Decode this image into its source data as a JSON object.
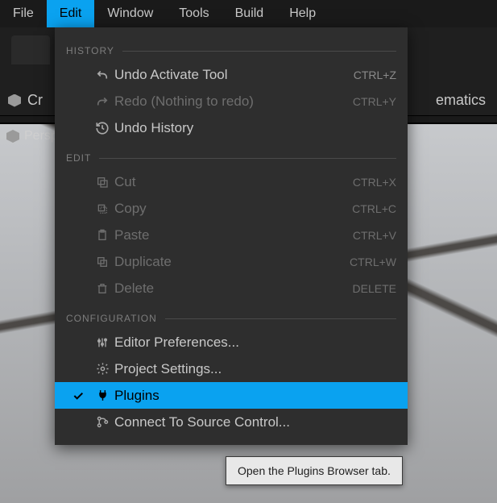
{
  "menubar": [
    "File",
    "Edit",
    "Window",
    "Tools",
    "Build",
    "Help"
  ],
  "menubar_active_index": 1,
  "toolbar": {
    "left_fragment": "Cr",
    "right_fragment": "ematics"
  },
  "viewport_label": "Persp",
  "dropdown": {
    "sections": [
      {
        "title": "HISTORY",
        "items": [
          {
            "icon": "undo",
            "label": "Undo Activate Tool",
            "shortcut": "CTRL+Z",
            "disabled": false
          },
          {
            "icon": "redo",
            "label": "Redo (Nothing to redo)",
            "shortcut": "CTRL+Y",
            "disabled": true
          },
          {
            "icon": "undo-history",
            "label": "Undo History",
            "shortcut": "",
            "disabled": false
          }
        ]
      },
      {
        "title": "EDIT",
        "items": [
          {
            "icon": "cut",
            "label": "Cut",
            "shortcut": "CTRL+X",
            "disabled": true
          },
          {
            "icon": "copy",
            "label": "Copy",
            "shortcut": "CTRL+C",
            "disabled": true
          },
          {
            "icon": "paste",
            "label": "Paste",
            "shortcut": "CTRL+V",
            "disabled": true
          },
          {
            "icon": "duplicate",
            "label": "Duplicate",
            "shortcut": "CTRL+W",
            "disabled": true
          },
          {
            "icon": "delete",
            "label": "Delete",
            "shortcut": "DELETE",
            "disabled": true
          }
        ]
      },
      {
        "title": "CONFIGURATION",
        "items": [
          {
            "icon": "sliders",
            "label": "Editor Preferences...",
            "shortcut": "",
            "disabled": false
          },
          {
            "icon": "gear",
            "label": "Project Settings...",
            "shortcut": "",
            "disabled": false
          },
          {
            "icon": "plug",
            "label": "Plugins",
            "shortcut": "",
            "disabled": false,
            "highlight": true,
            "checked": true
          },
          {
            "icon": "source-control",
            "label": "Connect To Source Control...",
            "shortcut": "",
            "disabled": false
          }
        ]
      }
    ]
  },
  "tooltip": "Open the Plugins Browser tab."
}
